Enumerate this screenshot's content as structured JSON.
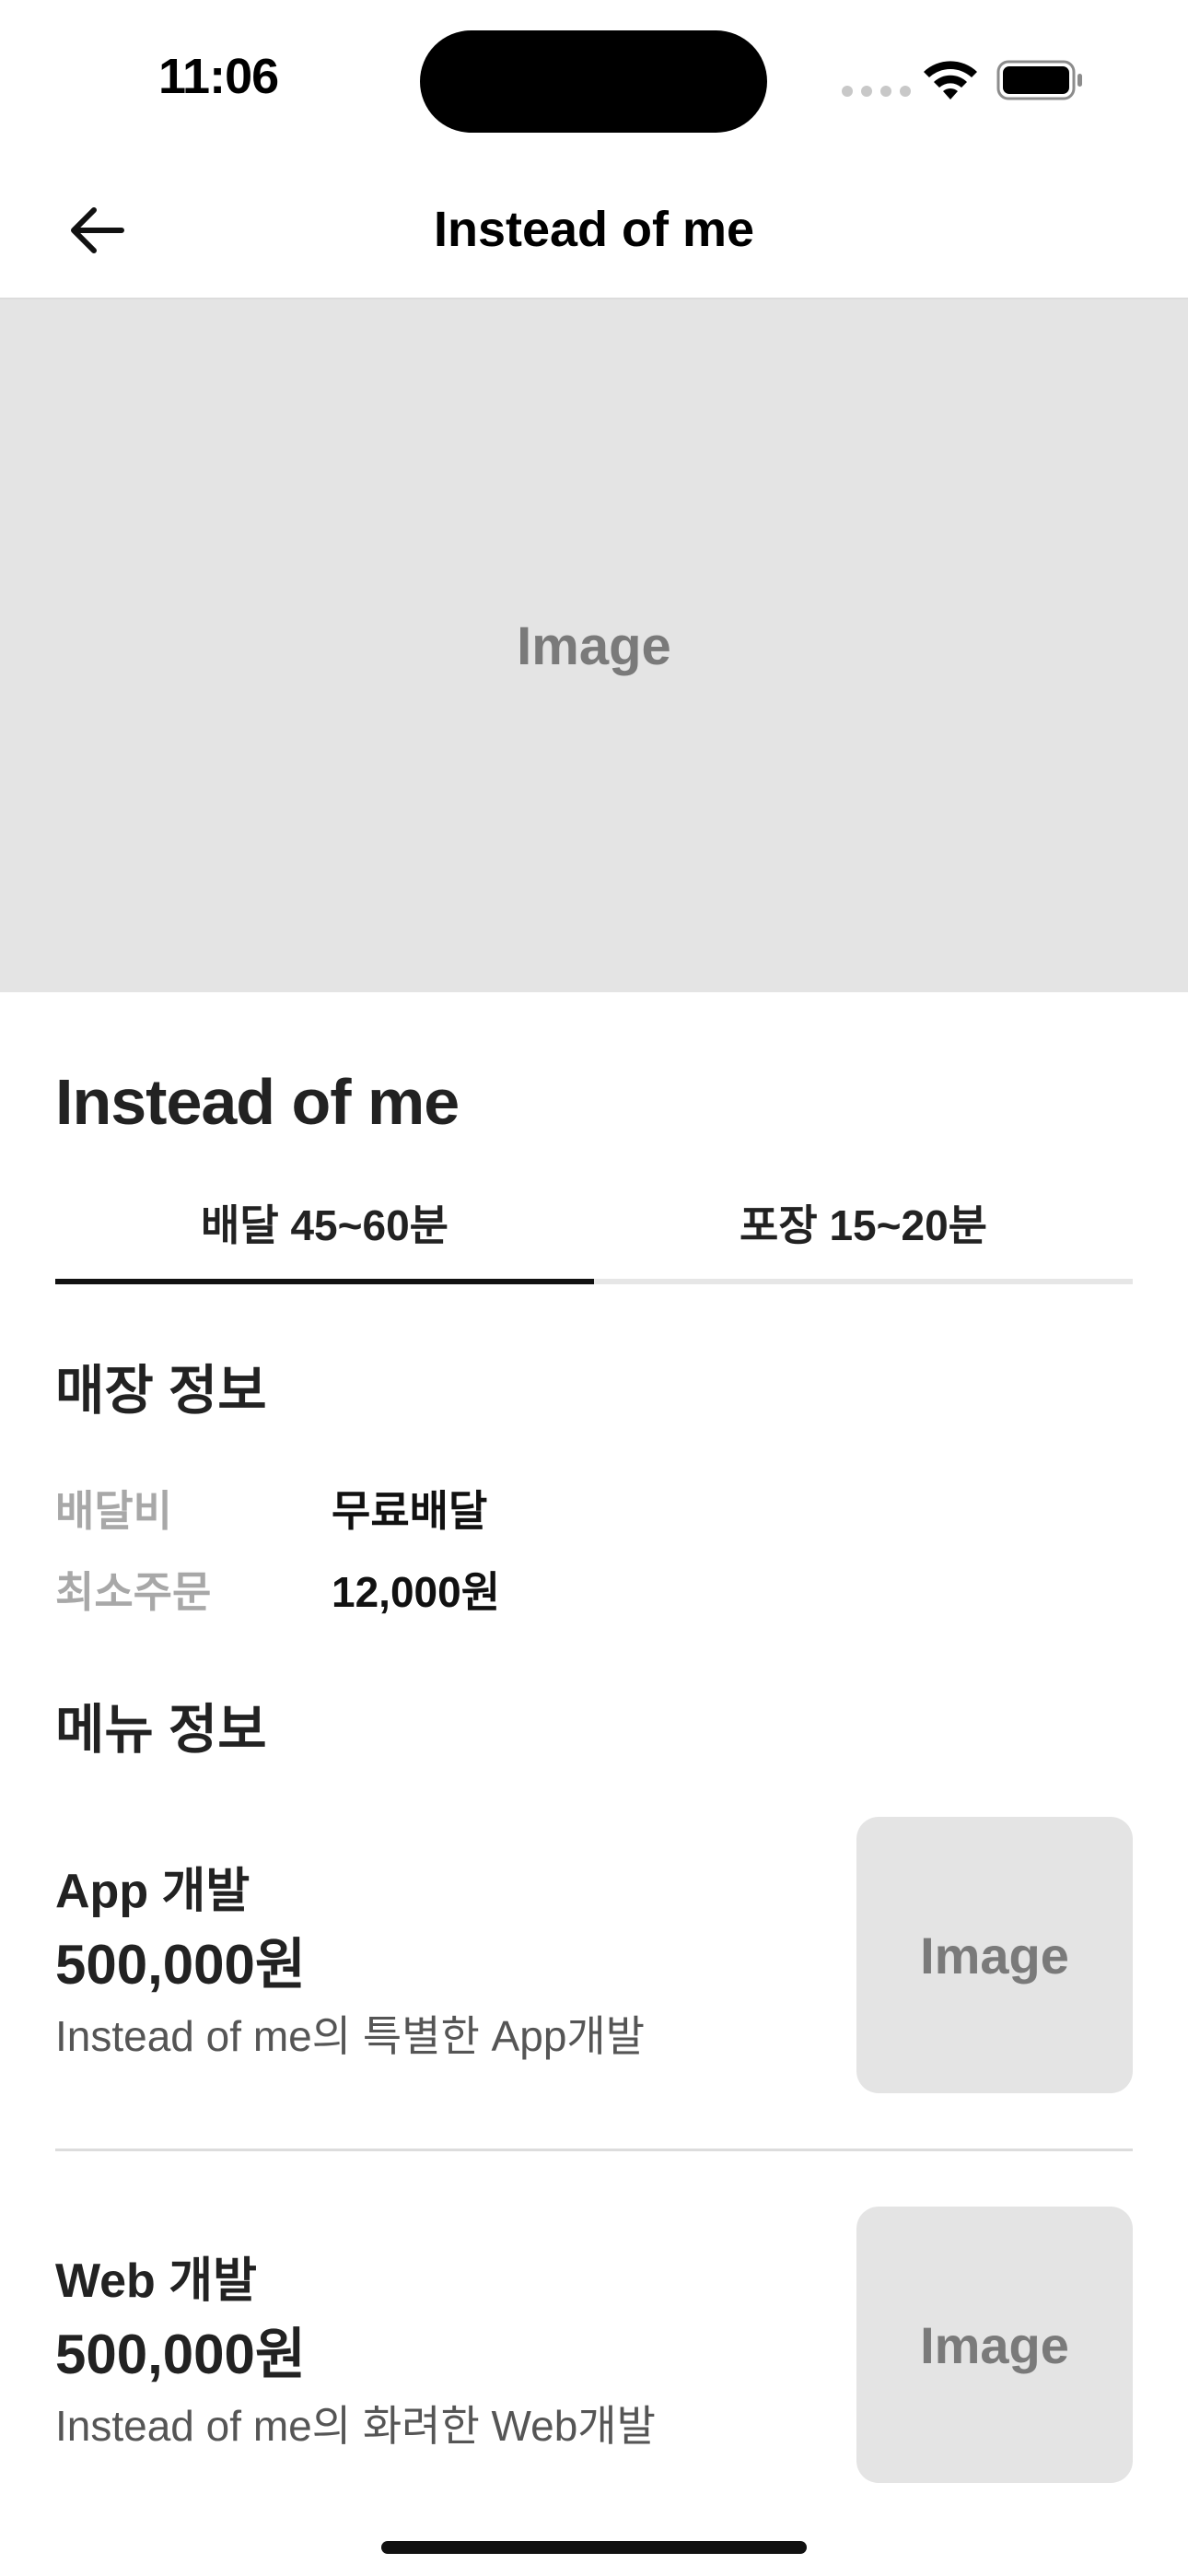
{
  "status_bar": {
    "time": "11:06"
  },
  "nav": {
    "title": "Instead of me",
    "back_icon": "arrow-left-icon"
  },
  "hero": {
    "image_label": "Image"
  },
  "store": {
    "name": "Instead of me"
  },
  "tabs": [
    {
      "label": "배달 45~60분",
      "active": true
    },
    {
      "label": "포장 15~20분",
      "active": false
    }
  ],
  "store_info": {
    "section_title": "매장 정보",
    "rows": [
      {
        "label": "배달비",
        "value": "무료배달"
      },
      {
        "label": "최소주문",
        "value": "12,000원"
      }
    ]
  },
  "menu_info": {
    "section_title": "메뉴 정보",
    "items": [
      {
        "name": "App 개발",
        "price": "500,000원",
        "description": "Instead of me의 특별한 App개발",
        "image_label": "Image"
      },
      {
        "name": "Web 개발",
        "price": "500,000원",
        "description": "Instead of me의 화려한 Web개발",
        "image_label": "Image"
      }
    ]
  }
}
